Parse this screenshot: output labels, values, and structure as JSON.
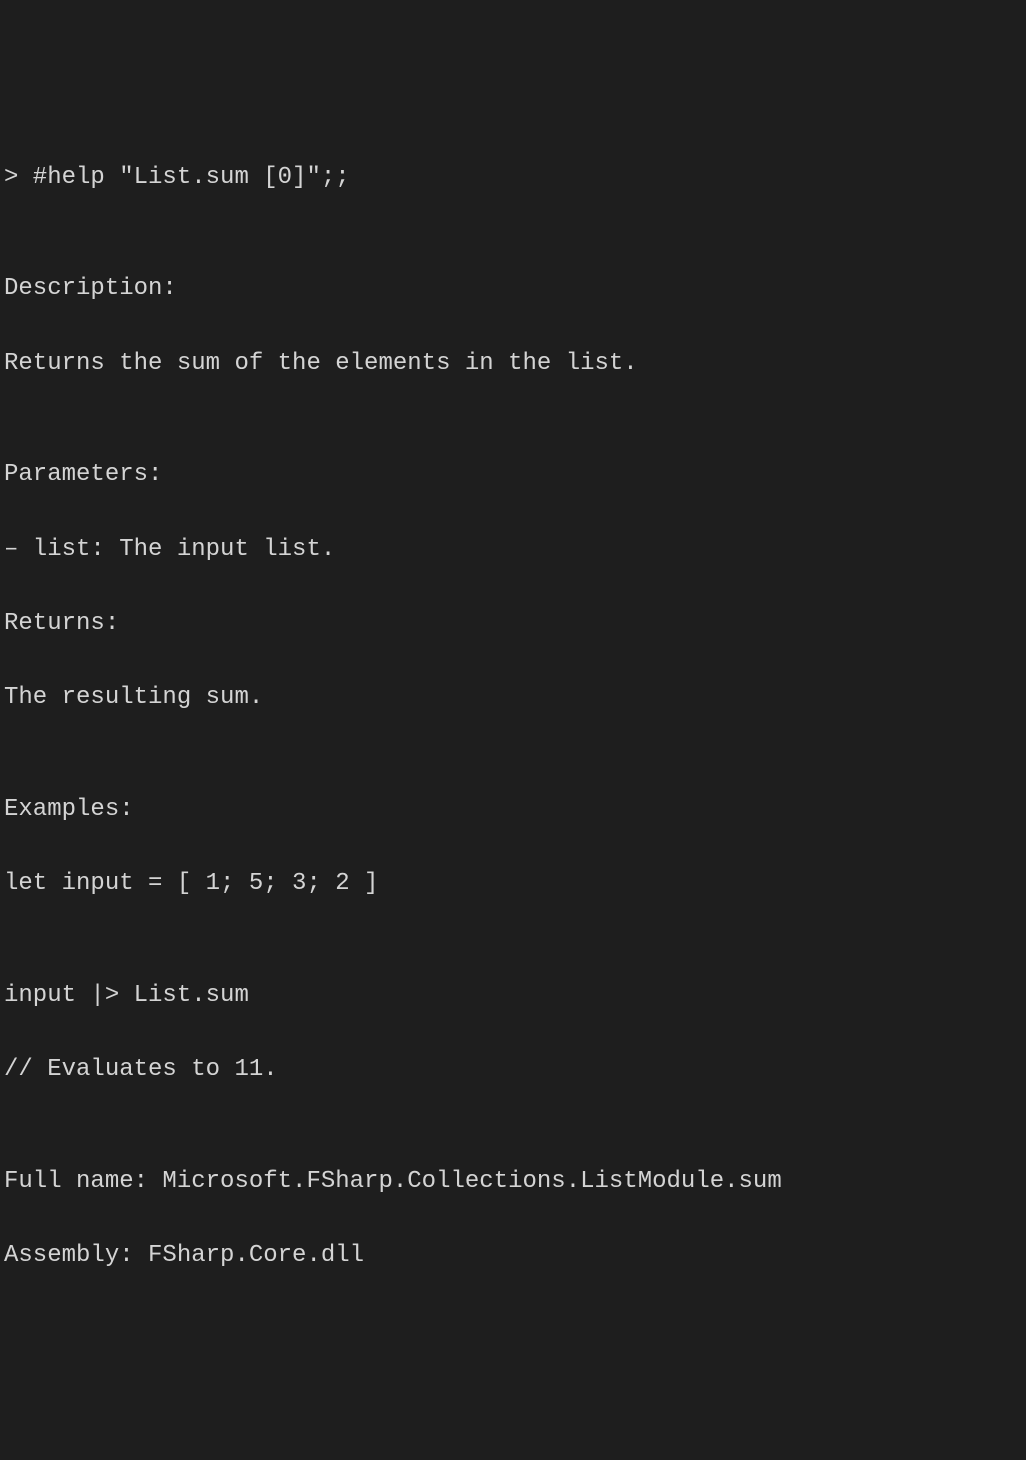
{
  "lines": {
    "command": "> #help \"List.sum [0]\";;",
    "desc_header": "Description:",
    "desc_text": "Returns the sum of the elements in the list.",
    "params_header": "Parameters:",
    "params_item": "– list: The input list.",
    "returns_header": "Returns:",
    "returns_text": "The resulting sum.",
    "examples_header": "Examples:",
    "ex_line1": "let input = [ 1; 5; 3; 2 ]",
    "ex_line2": "input |> List.sum",
    "ex_line3": "// Evaluates to 11.",
    "fullname": "Full name: Microsoft.FSharp.Collections.ListModule.sum",
    "assembly": "Assembly: FSharp.Core.dll"
  }
}
